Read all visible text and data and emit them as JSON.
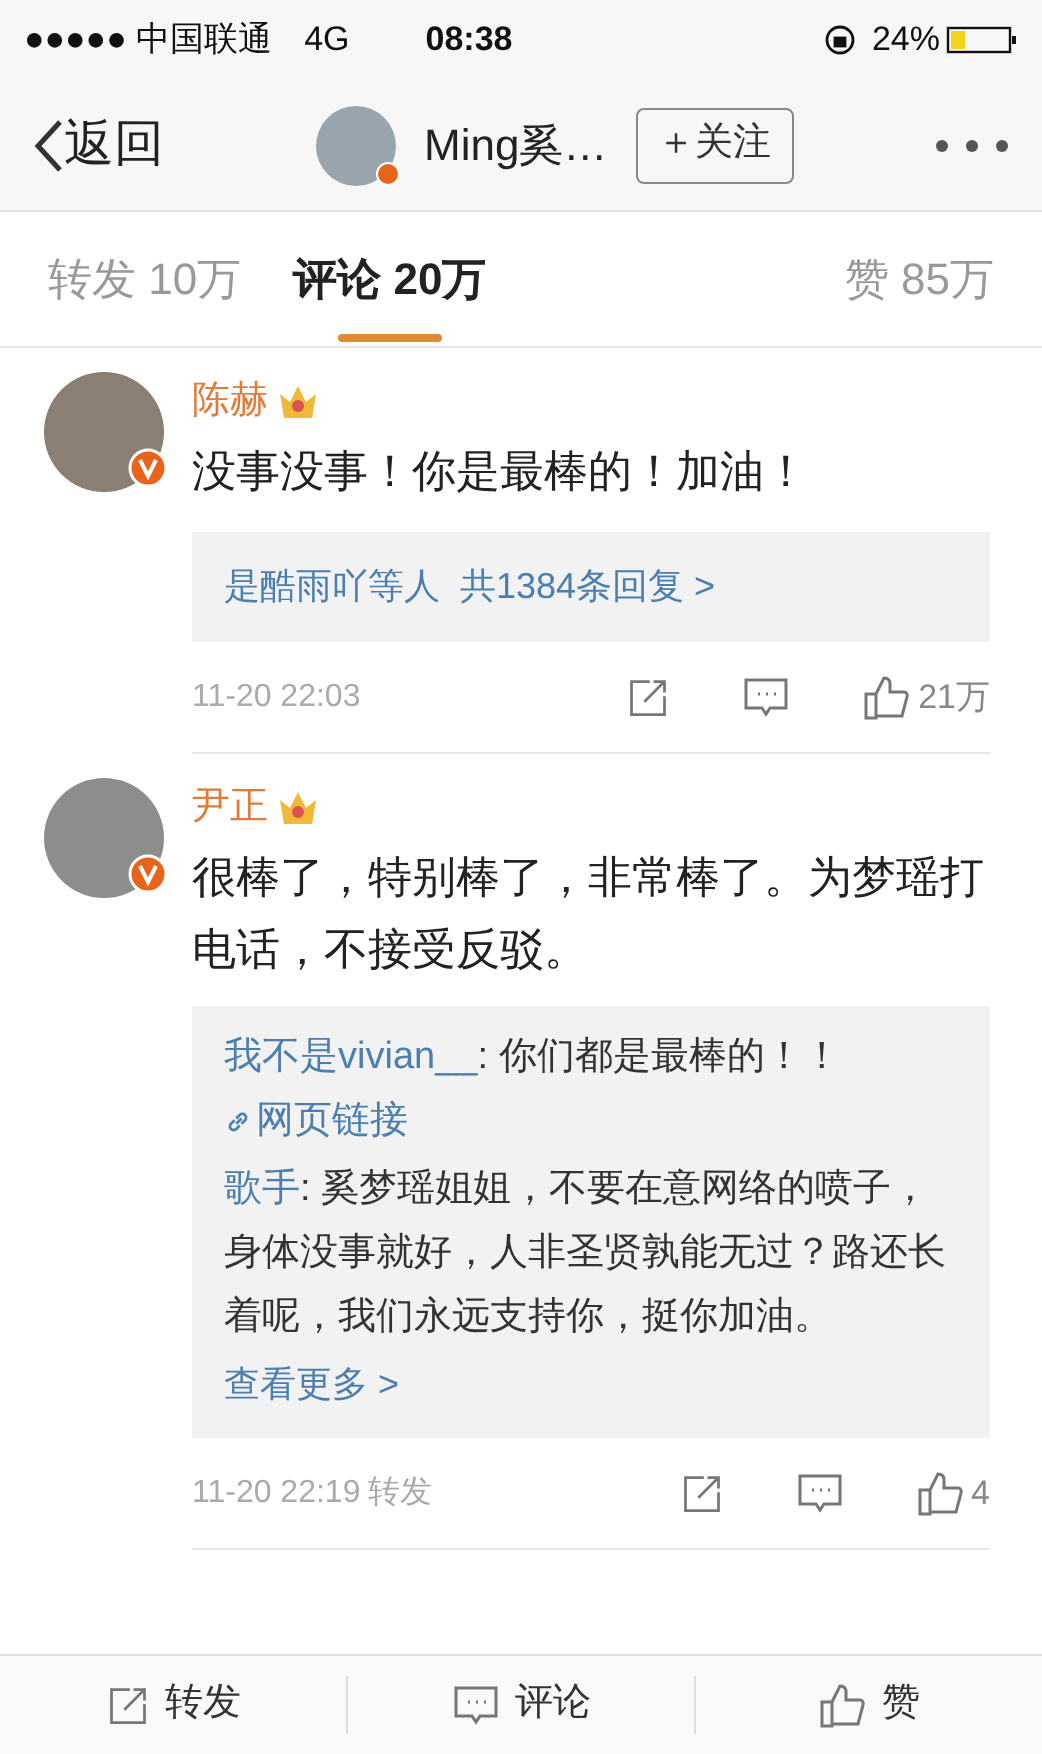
{
  "status_bar": {
    "carrier": "●●●●● 中国联通",
    "network": "4G",
    "time": "08:38",
    "battery": "24%"
  },
  "nav": {
    "back": "返回",
    "author": "Ming奚…",
    "follow": "＋关注"
  },
  "tabs": [
    {
      "label": "转发",
      "count": "10万",
      "selected": false
    },
    {
      "label": "评论",
      "count": "20万",
      "selected": true
    },
    {
      "label": "赞",
      "count": "85万",
      "selected": false
    }
  ],
  "comments": [
    {
      "name": "陈赫",
      "body": "没事没事！你是最棒的！加油！",
      "summary": {
        "users": "是酷雨吖等人",
        "total": "共1384条回复 >"
      },
      "time": "11-20 22:03",
      "likes": "21万"
    },
    {
      "name": "尹正",
      "body": "很棒了，特别棒了，非常棒了。为梦瑶打电话，不接受反驳。",
      "replies": [
        {
          "user": "我不是vivian__",
          "text": ": 你们都是最棒的！！",
          "link": "网页链接"
        },
        {
          "user": "歌手",
          "text": ": 奚梦瑶姐姐，不要在意网络的喷子，身体没事就好，人非圣贤孰能无过？路还长着呢，我们永远支持你，挺你加油。"
        }
      ],
      "more": "查看更多 >",
      "time": "11-20 22:19",
      "repost": "转发",
      "likes": "4"
    }
  ],
  "bottom_bar": [
    {
      "label": "转发"
    },
    {
      "label": "评论"
    },
    {
      "label": "赞"
    }
  ]
}
